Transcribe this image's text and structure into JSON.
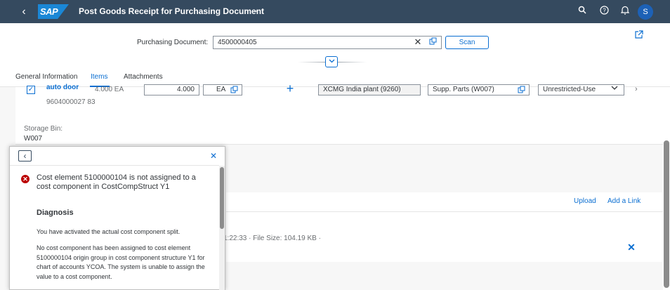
{
  "shell": {
    "logo_text": "SAP",
    "app_title": "Post Goods Receipt for Purchasing Document",
    "avatar_initial": "S"
  },
  "header": {
    "purchasing_document_label": "Purchasing Document:",
    "purchasing_document_value": "4500000405",
    "scan_label": "Scan"
  },
  "tabs": [
    {
      "label": "General Information"
    },
    {
      "label": "Items"
    },
    {
      "label": "Attachments"
    }
  ],
  "active_tab": "Items",
  "item": {
    "name": "auto door",
    "quantity_text": "4.000 EA",
    "number": "9604000027 83",
    "quantity_value": "4.000",
    "unit": "EA",
    "plant": "XCMG India plant (9260)",
    "storage_location": "Supp. Parts (W007)",
    "stock_type": "Unrestricted-Use",
    "storage_bin_label": "Storage Bin:",
    "storage_bin_value": "W007"
  },
  "attachments": {
    "upload_label": "Upload",
    "add_link_label": "Add a Link",
    "file_meta": "1:22:33 · File Size: 104.19 KB ·"
  },
  "message": {
    "title": "Cost element 5100000104 is not assigned to a cost component in CostCompStruct Y1",
    "diagnosis_heading": "Diagnosis",
    "diagnosis_p1": "You have activated the actual cost component split.",
    "diagnosis_p2": "No cost component has been assigned to cost element 5100000104 origin group  in cost component structure Y1 for chart of accounts YCOA. The system is unable to assign the value to a cost component."
  },
  "colors": {
    "shell_bg": "#354a5f",
    "brand_blue": "#0a6ed1",
    "error_red": "#bb0000"
  }
}
